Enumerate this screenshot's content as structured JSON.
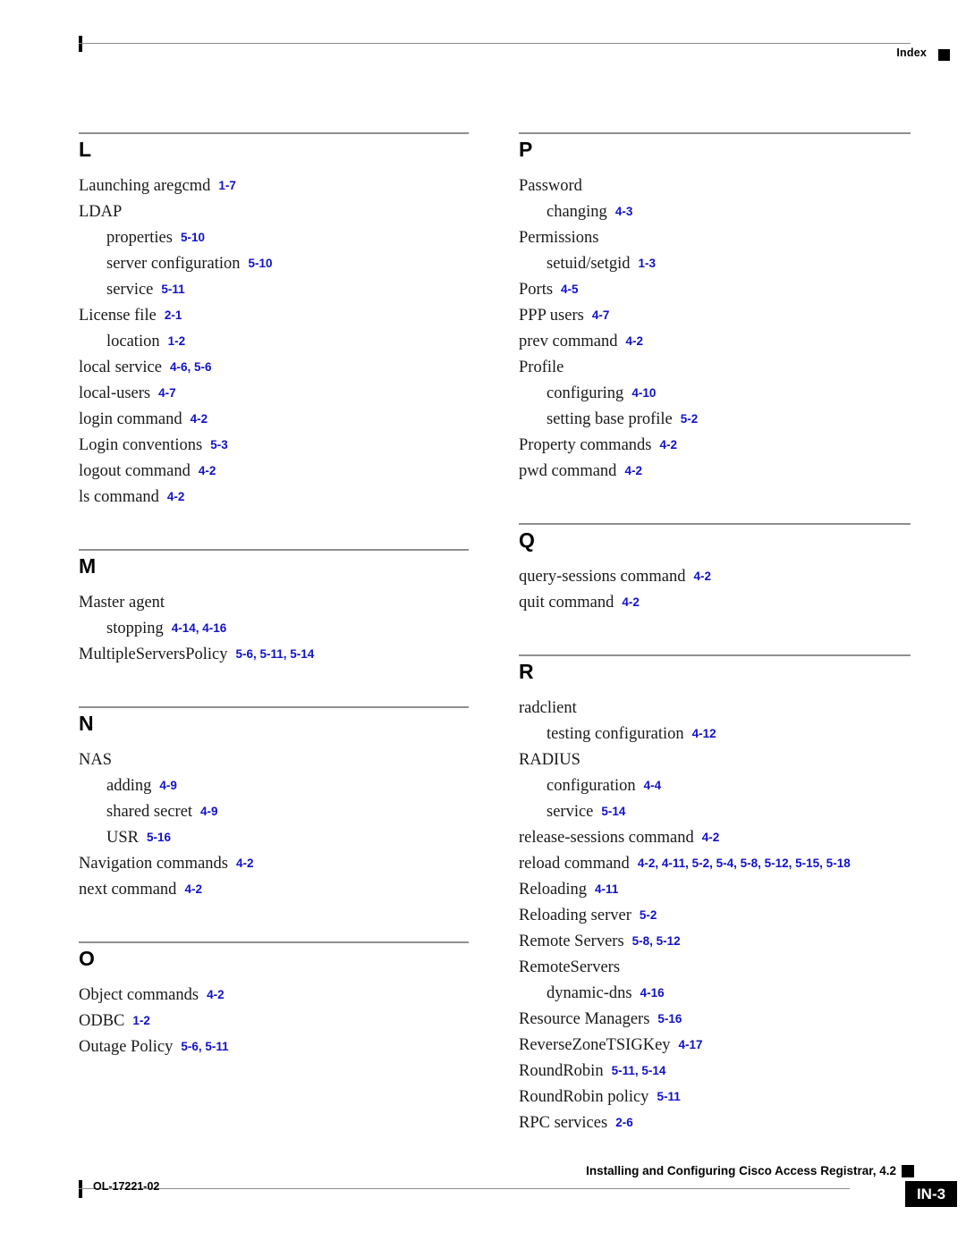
{
  "header": {
    "title": "Index"
  },
  "footer": {
    "doc_id": "OL-17221-02",
    "book_title": "Installing and Configuring Cisco Access Registrar, 4.2",
    "page_number": "IN-3"
  },
  "colors": {
    "page_reference": "#1111cc",
    "rule": "#8f8f8f",
    "text": "#1a1a1a",
    "marker": "#000000"
  },
  "columns": [
    {
      "name": "left",
      "blocks": [
        {
          "letter": "L",
          "entries": [
            {
              "level": 1,
              "term": "Launching aregcmd",
              "pages": "1-7"
            },
            {
              "level": 1,
              "term": "LDAP",
              "pages": ""
            },
            {
              "level": 2,
              "term": "properties",
              "pages": "5-10"
            },
            {
              "level": 2,
              "term": "server configuration",
              "pages": "5-10"
            },
            {
              "level": 2,
              "term": "service",
              "pages": "5-11"
            },
            {
              "level": 1,
              "term": "License file",
              "pages": "2-1"
            },
            {
              "level": 2,
              "term": "location",
              "pages": "1-2"
            },
            {
              "level": 1,
              "term": "local service",
              "pages": "4-6, 5-6"
            },
            {
              "level": 1,
              "term": "local-users",
              "pages": "4-7"
            },
            {
              "level": 1,
              "term": "login command",
              "pages": "4-2"
            },
            {
              "level": 1,
              "term": "Login conventions",
              "pages": "5-3"
            },
            {
              "level": 1,
              "term": "logout command",
              "pages": "4-2"
            },
            {
              "level": 1,
              "term": "ls command",
              "pages": "4-2"
            }
          ]
        },
        {
          "letter": "M",
          "entries": [
            {
              "level": 1,
              "term": "Master agent",
              "pages": ""
            },
            {
              "level": 2,
              "term": "stopping",
              "pages": "4-14, 4-16"
            },
            {
              "level": 1,
              "term": "MultipleServersPolicy",
              "pages": "5-6, 5-11, 5-14"
            }
          ]
        },
        {
          "letter": "N",
          "entries": [
            {
              "level": 1,
              "term": "NAS",
              "pages": ""
            },
            {
              "level": 2,
              "term": "adding",
              "pages": "4-9"
            },
            {
              "level": 2,
              "term": "shared secret",
              "pages": "4-9"
            },
            {
              "level": 2,
              "term": "USR",
              "pages": "5-16"
            },
            {
              "level": 1,
              "term": "Navigation commands",
              "pages": "4-2"
            },
            {
              "level": 1,
              "term": "next command",
              "pages": "4-2"
            }
          ]
        },
        {
          "letter": "O",
          "entries": [
            {
              "level": 1,
              "term": "Object commands",
              "pages": "4-2"
            },
            {
              "level": 1,
              "term": "ODBC",
              "pages": "1-2"
            },
            {
              "level": 1,
              "term": "Outage Policy",
              "pages": "5-6, 5-11"
            }
          ]
        }
      ]
    },
    {
      "name": "right",
      "blocks": [
        {
          "letter": "P",
          "entries": [
            {
              "level": 1,
              "term": "Password",
              "pages": ""
            },
            {
              "level": 2,
              "term": "changing",
              "pages": "4-3"
            },
            {
              "level": 1,
              "term": "Permissions",
              "pages": ""
            },
            {
              "level": 2,
              "term": "setuid/setgid",
              "pages": "1-3"
            },
            {
              "level": 1,
              "term": "Ports",
              "pages": "4-5"
            },
            {
              "level": 1,
              "term": "PPP users",
              "pages": "4-7"
            },
            {
              "level": 1,
              "term": "prev command",
              "pages": "4-2"
            },
            {
              "level": 1,
              "term": "Profile",
              "pages": ""
            },
            {
              "level": 2,
              "term": "configuring",
              "pages": "4-10"
            },
            {
              "level": 2,
              "term": "setting base profile",
              "pages": "5-2"
            },
            {
              "level": 1,
              "term": "Property commands",
              "pages": "4-2"
            },
            {
              "level": 1,
              "term": "pwd command",
              "pages": "4-2"
            }
          ]
        },
        {
          "letter": "Q",
          "entries": [
            {
              "level": 1,
              "term": "query-sessions command",
              "pages": "4-2"
            },
            {
              "level": 1,
              "term": "quit command",
              "pages": "4-2"
            }
          ]
        },
        {
          "letter": "R",
          "entries": [
            {
              "level": 1,
              "term": "radclient",
              "pages": ""
            },
            {
              "level": 2,
              "term": "testing configuration",
              "pages": "4-12"
            },
            {
              "level": 1,
              "term": "RADIUS",
              "pages": ""
            },
            {
              "level": 2,
              "term": "configuration",
              "pages": "4-4"
            },
            {
              "level": 2,
              "term": "service",
              "pages": "5-14"
            },
            {
              "level": 1,
              "term": "release-sessions command",
              "pages": "4-2"
            },
            {
              "level": 1,
              "term": "reload command",
              "pages": "4-2, 4-11, 5-2, 5-4, 5-8, 5-12, 5-15, 5-18"
            },
            {
              "level": 1,
              "term": "Reloading",
              "pages": "4-11"
            },
            {
              "level": 1,
              "term": "Reloading server",
              "pages": "5-2"
            },
            {
              "level": 1,
              "term": "Remote Servers",
              "pages": "5-8, 5-12"
            },
            {
              "level": 1,
              "term": "RemoteServers",
              "pages": ""
            },
            {
              "level": 2,
              "term": "dynamic-dns",
              "pages": "4-16"
            },
            {
              "level": 1,
              "term": "Resource Managers",
              "pages": "5-16"
            },
            {
              "level": 1,
              "term": "ReverseZoneTSIGKey",
              "pages": "4-17"
            },
            {
              "level": 1,
              "term": "RoundRobin",
              "pages": "5-11, 5-14"
            },
            {
              "level": 1,
              "term": "RoundRobin policy",
              "pages": "5-11"
            },
            {
              "level": 1,
              "term": "RPC services",
              "pages": "2-6"
            }
          ]
        }
      ]
    }
  ]
}
